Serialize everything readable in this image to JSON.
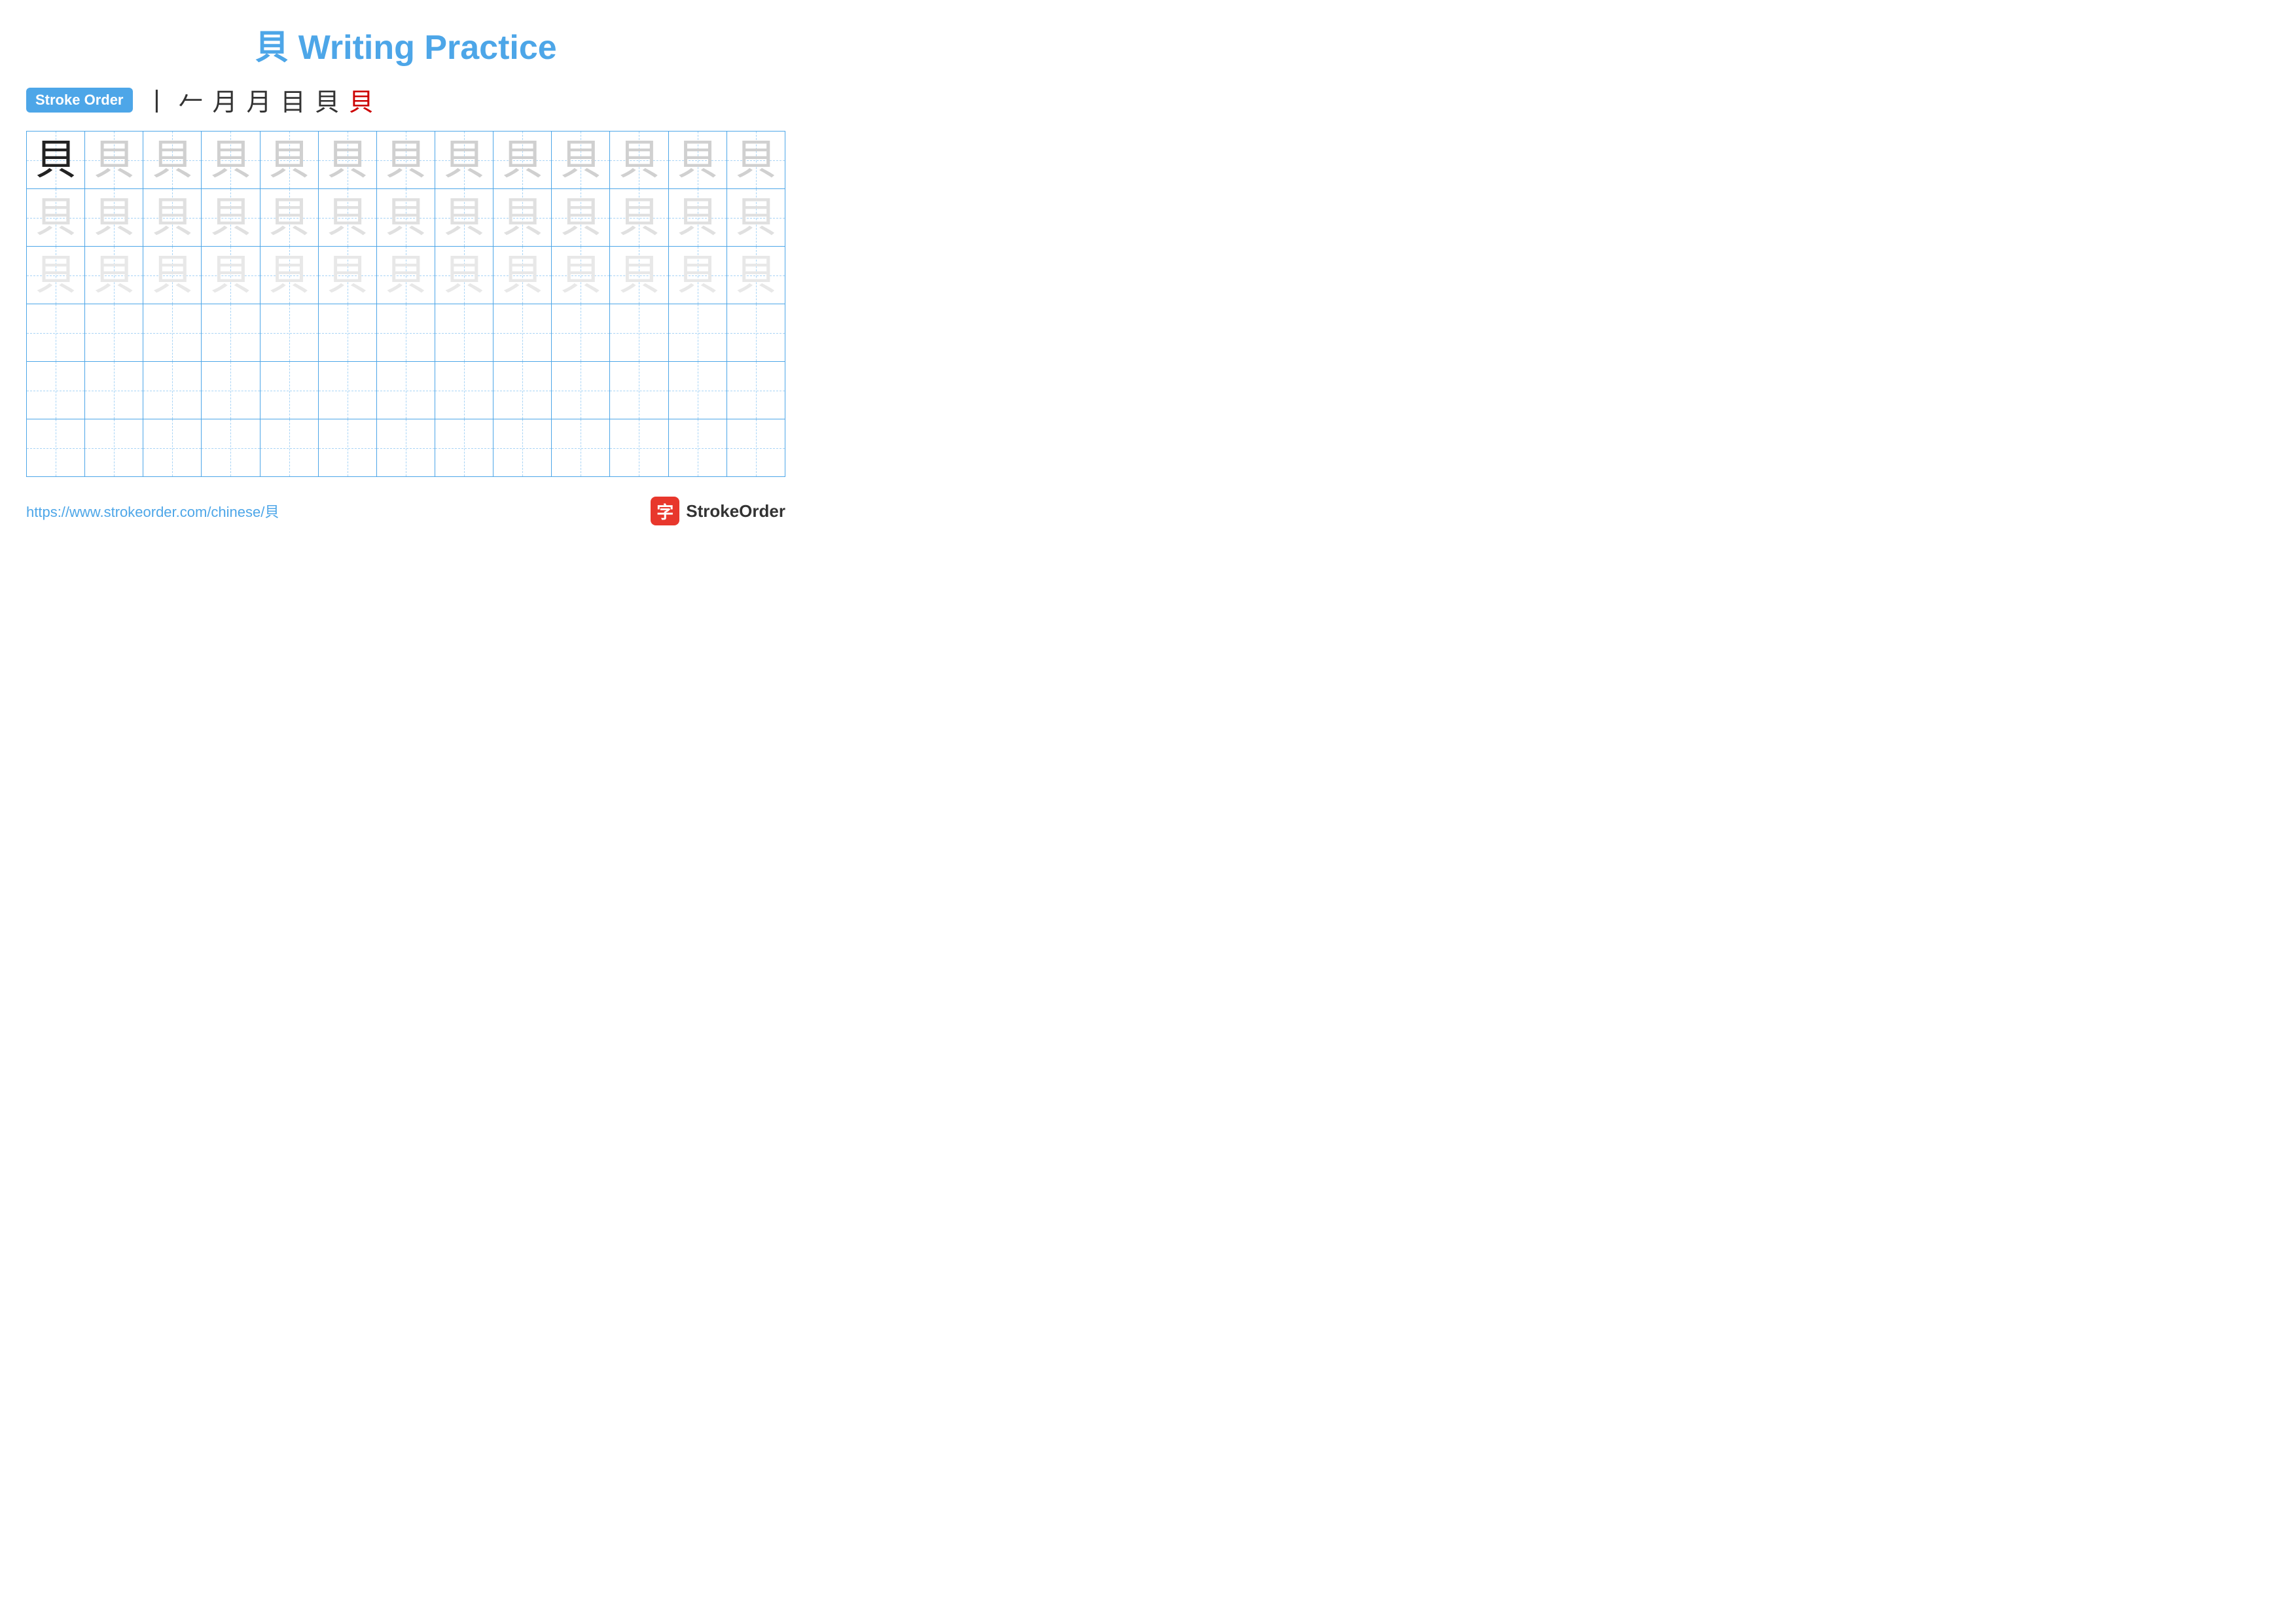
{
  "title": {
    "char": "貝",
    "text": " Writing Practice"
  },
  "stroke_order": {
    "badge_label": "Stroke Order",
    "strokes": [
      "丨",
      "𠂉",
      "月",
      "月",
      "目",
      "貝",
      "貝"
    ]
  },
  "grid": {
    "rows": 6,
    "cols": 13,
    "character": "貝",
    "row1_first_dark": true,
    "filled_rows": 3
  },
  "footer": {
    "link": "https://www.strokeorder.com/chinese/貝",
    "logo_char": "字",
    "logo_text": "StrokeOrder"
  }
}
